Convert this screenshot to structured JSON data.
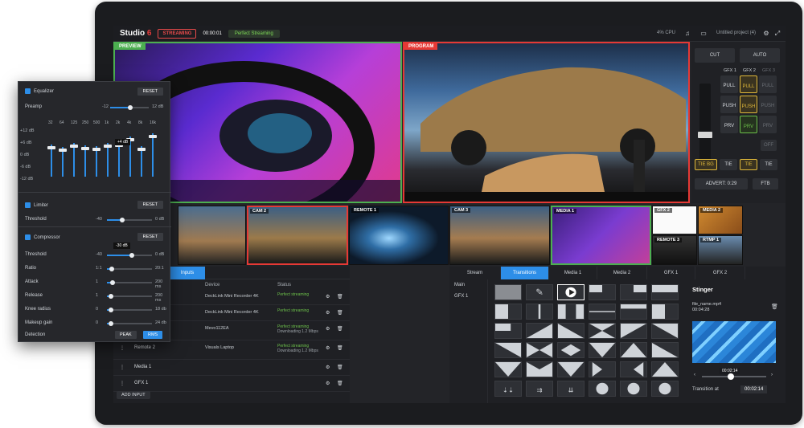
{
  "app": {
    "logo": "Studio",
    "logo_number": "6",
    "streaming_button": "STREAMING",
    "time": "00:00:01",
    "status": "Perfect Streaming",
    "cpu": "4% CPU",
    "project": "Untitled project (4)"
  },
  "monitors": {
    "preview_label": "PREVIEW",
    "program_label": "PROGRAM"
  },
  "controls": {
    "cut": "CUT",
    "auto": "AUTO",
    "gfx_headers": [
      "GFX 1",
      "GFX 2",
      "GFX 3"
    ],
    "pull": "PULL",
    "push": "PUSH",
    "prv": "PRV",
    "tie_bg": "TIE BG",
    "tie": "TIE",
    "off": "OFF",
    "advert": "ADVERT: 0:29",
    "ftb": "FTB"
  },
  "thumbnails": [
    {
      "label": ""
    },
    {
      "label": "CAM 2"
    },
    {
      "label": "REMOTE 1"
    },
    {
      "label": "CAM 3"
    },
    {
      "label": "MEDIA 1"
    },
    {
      "label": "GFX 2"
    },
    {
      "label": "MEDIA 2"
    },
    {
      "label": "REMOTE 3"
    },
    {
      "label": "RTMP 1"
    }
  ],
  "inputs": {
    "tab": "Inputs",
    "col_device": "Device",
    "col_status": "Status",
    "rows": [
      {
        "name": "",
        "device": "DeckLink Mini Recorder 4K",
        "status": "Perfect streaming",
        "sub": ""
      },
      {
        "name": "",
        "device": "DeckLink Mini Recorder 4K",
        "status": "Perfect streaming",
        "sub": ""
      },
      {
        "name": "",
        "device": "Mevo112EA",
        "status": "Perfect streaming",
        "sub": "Downloading 1.2 Mbps"
      },
      {
        "name": "Remote 2",
        "device": "Visuals Laptop",
        "status": "Perfect streaming",
        "sub": "Downloading 1.2 Mbps"
      },
      {
        "name": "Media 1",
        "device": "",
        "status": "",
        "sub": ""
      },
      {
        "name": "GFX 1",
        "device": "",
        "status": "",
        "sub": ""
      }
    ],
    "add_input": "ADD INPUT"
  },
  "transitions": {
    "tabs": [
      "Stream",
      "Transitions",
      "Media 1",
      "Media 2",
      "GFX 1",
      "GFX 2"
    ],
    "active_tab": "Transitions",
    "side": [
      "Main",
      "GFX 1"
    ],
    "stinger_title": "Stinger",
    "file_name": "file_name.mp4",
    "file_duration": "00:04:28",
    "frame_time": "00:02:14",
    "transition_at_label": "Transition at",
    "transition_at_value": "00:02:14"
  },
  "audio": {
    "equalizer": "Equalizer",
    "reset": "RESET",
    "preamp_label": "Preamp",
    "preamp_min": "-12",
    "preamp_max": "12 dB",
    "db_scale": [
      "+12 dB",
      "+6 dB",
      "0 dB",
      "-6 dB",
      "-12 dB"
    ],
    "freqs": [
      "32",
      "64",
      "125",
      "250",
      "500",
      "1k",
      "2k",
      "4k",
      "8k",
      "16k"
    ],
    "eq_tooltip": "+4 dB",
    "limiter": "Limiter",
    "threshold": "Threshold",
    "lim_min": "-40",
    "lim_max": "0 dB",
    "compressor": "Compressor",
    "comp_tooltip": "-30 dB",
    "comp_rows": [
      {
        "label": "Threshold",
        "min": "-40",
        "max": "0 dB"
      },
      {
        "label": "Ratio",
        "min": "1:1",
        "max": "20:1"
      },
      {
        "label": "Attack",
        "min": "1",
        "max": "200 ms"
      },
      {
        "label": "Release",
        "min": "1",
        "max": "200 ms"
      },
      {
        "label": "Knee radius",
        "min": "0",
        "max": "18 db"
      },
      {
        "label": "Makeup gain",
        "min": "0",
        "max": "24 db"
      }
    ],
    "detection": "Detection",
    "peak": "PEAK",
    "rms": "RMS"
  }
}
